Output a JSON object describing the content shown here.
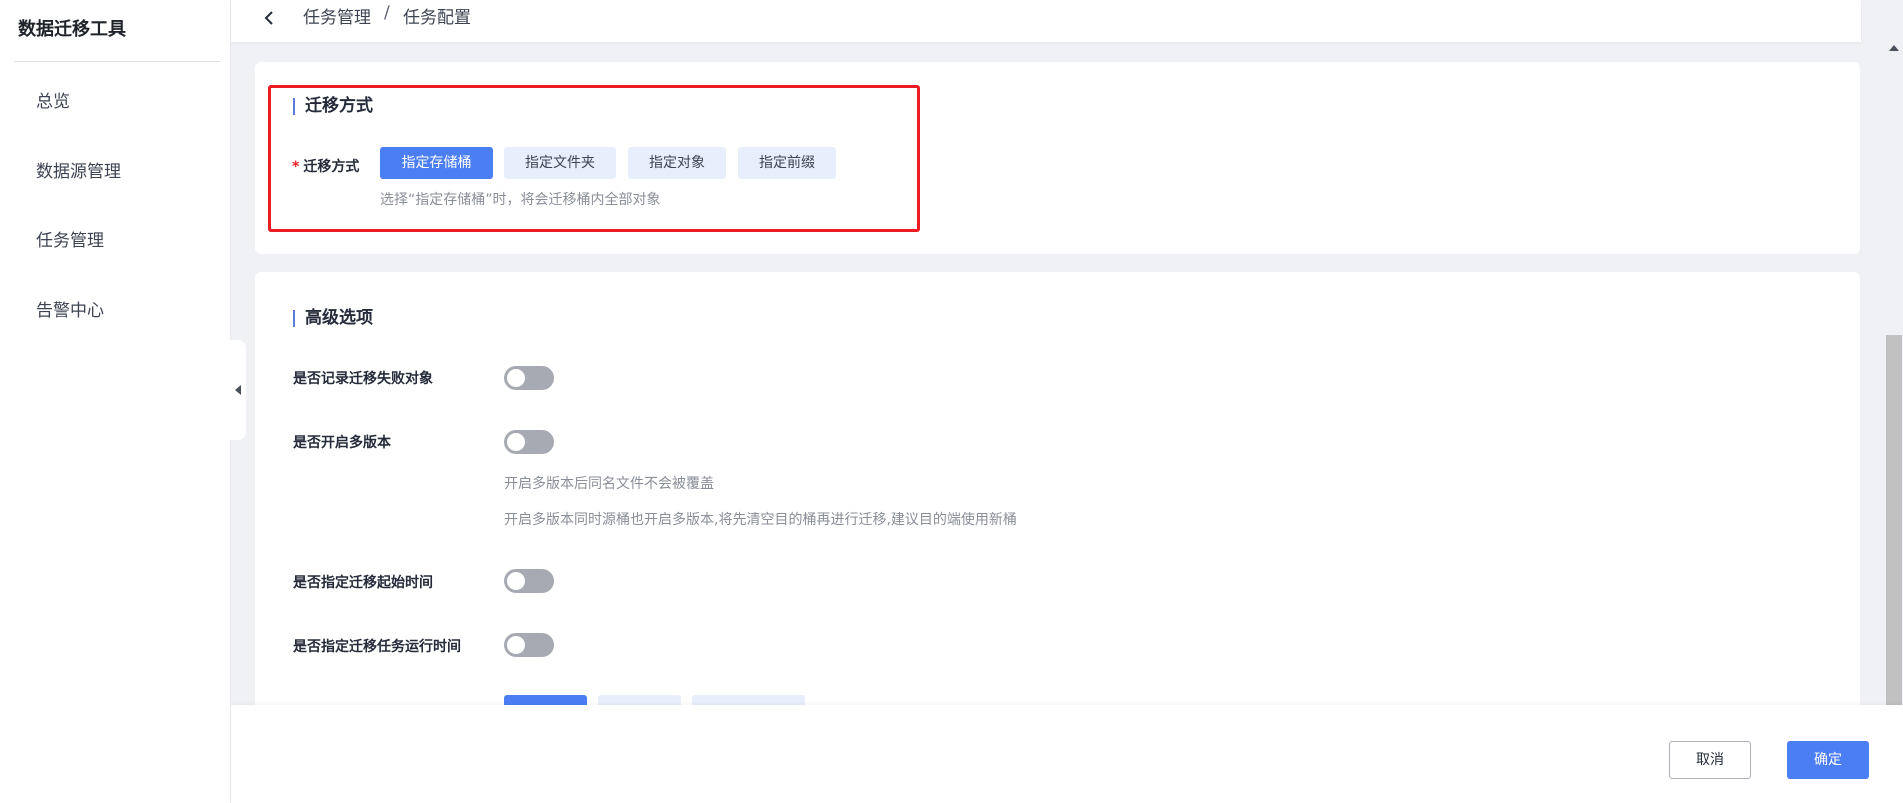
{
  "app": {
    "title": "数据迁移工具"
  },
  "sidebar": {
    "items": [
      {
        "label": "总览"
      },
      {
        "label": "数据源管理"
      },
      {
        "label": "任务管理"
      },
      {
        "label": "告警中心"
      }
    ]
  },
  "breadcrumb": {
    "parent": "任务管理",
    "separator": "/",
    "current": "任务配置"
  },
  "migration": {
    "section_title": "迁移方式",
    "field_label": "迁移方式",
    "required_mark": "*",
    "options": [
      {
        "label": "指定存储桶",
        "selected": true
      },
      {
        "label": "指定文件夹",
        "selected": false
      },
      {
        "label": "指定对象",
        "selected": false
      },
      {
        "label": "指定前缀",
        "selected": false
      }
    ],
    "hint": "选择“指定存储桶”时，将会迁移桶内全部对象"
  },
  "advanced": {
    "section_title": "高级选项",
    "record_failed": {
      "label": "是否记录迁移失败对象",
      "enabled": false
    },
    "multi_version": {
      "label": "是否开启多版本",
      "enabled": false,
      "hint1": "开启多版本后同名文件不会被覆盖",
      "hint2": "开启多版本同时源桶也开启多版本,将先清空目的桶再进行迁移,建议目的端使用新桶"
    },
    "start_time": {
      "label": "是否指定迁移起始时间",
      "enabled": false
    },
    "run_time": {
      "label": "是否指定迁移任务运行时间",
      "enabled": false
    }
  },
  "footer": {
    "cancel_label": "取消",
    "confirm_label": "确定"
  },
  "colors": {
    "accent": "#4b7df3",
    "highlight_border": "#ed1c24",
    "toggle_off": "#a7a9b3"
  },
  "icons": [
    "chevron-left-icon",
    "collapse-arrow-icon",
    "scroll-up-arrow-icon"
  ]
}
